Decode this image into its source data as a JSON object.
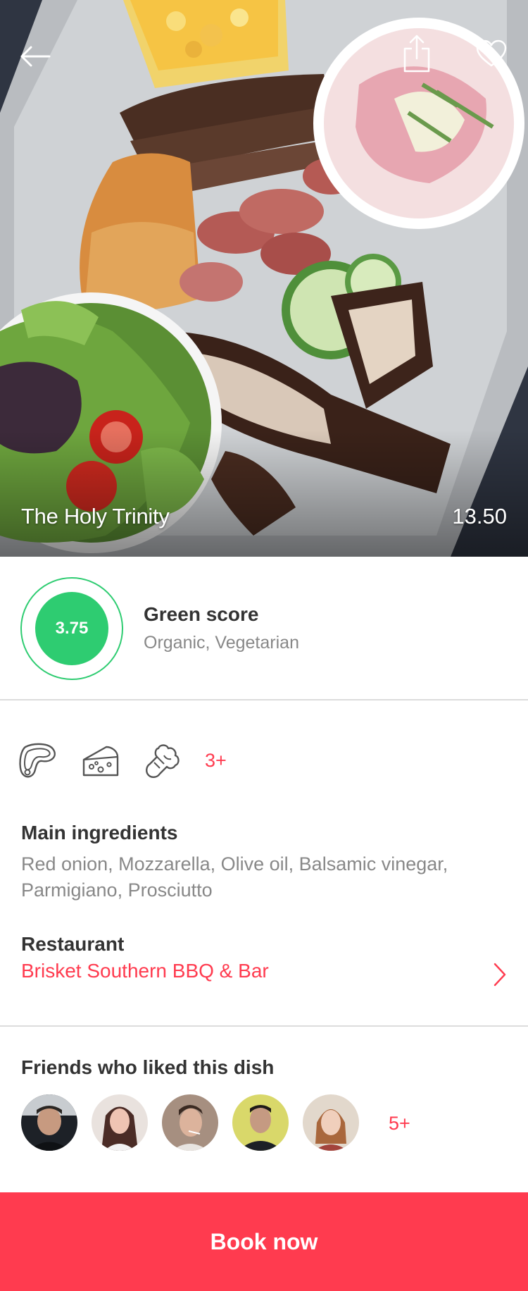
{
  "hero": {
    "dish_name": "The Holy Trinity",
    "price": "13.50",
    "back_icon": "arrow-left-icon",
    "share_icon": "share-icon",
    "favorite_icon": "heart-icon"
  },
  "green_score": {
    "value": "3.75",
    "title": "Green score",
    "tags": "Organic, Vegetarian",
    "color": "#2ecc71"
  },
  "ingredient_icons": [
    "meat-icon",
    "cheese-icon",
    "broccoli-icon"
  ],
  "ingredient_icons_more": "3+",
  "ingredients": {
    "title": "Main ingredients",
    "list": "Red onion, Mozzarella, Olive oil, Balsamic vinegar, Parmigiano, Prosciutto"
  },
  "restaurant": {
    "title": "Restaurant",
    "name": "Brisket Southern BBQ & Bar"
  },
  "friends": {
    "title": "Friends who liked this dish",
    "more": "5+"
  },
  "cta": {
    "label": "Book now",
    "color": "#ff3b4f"
  }
}
